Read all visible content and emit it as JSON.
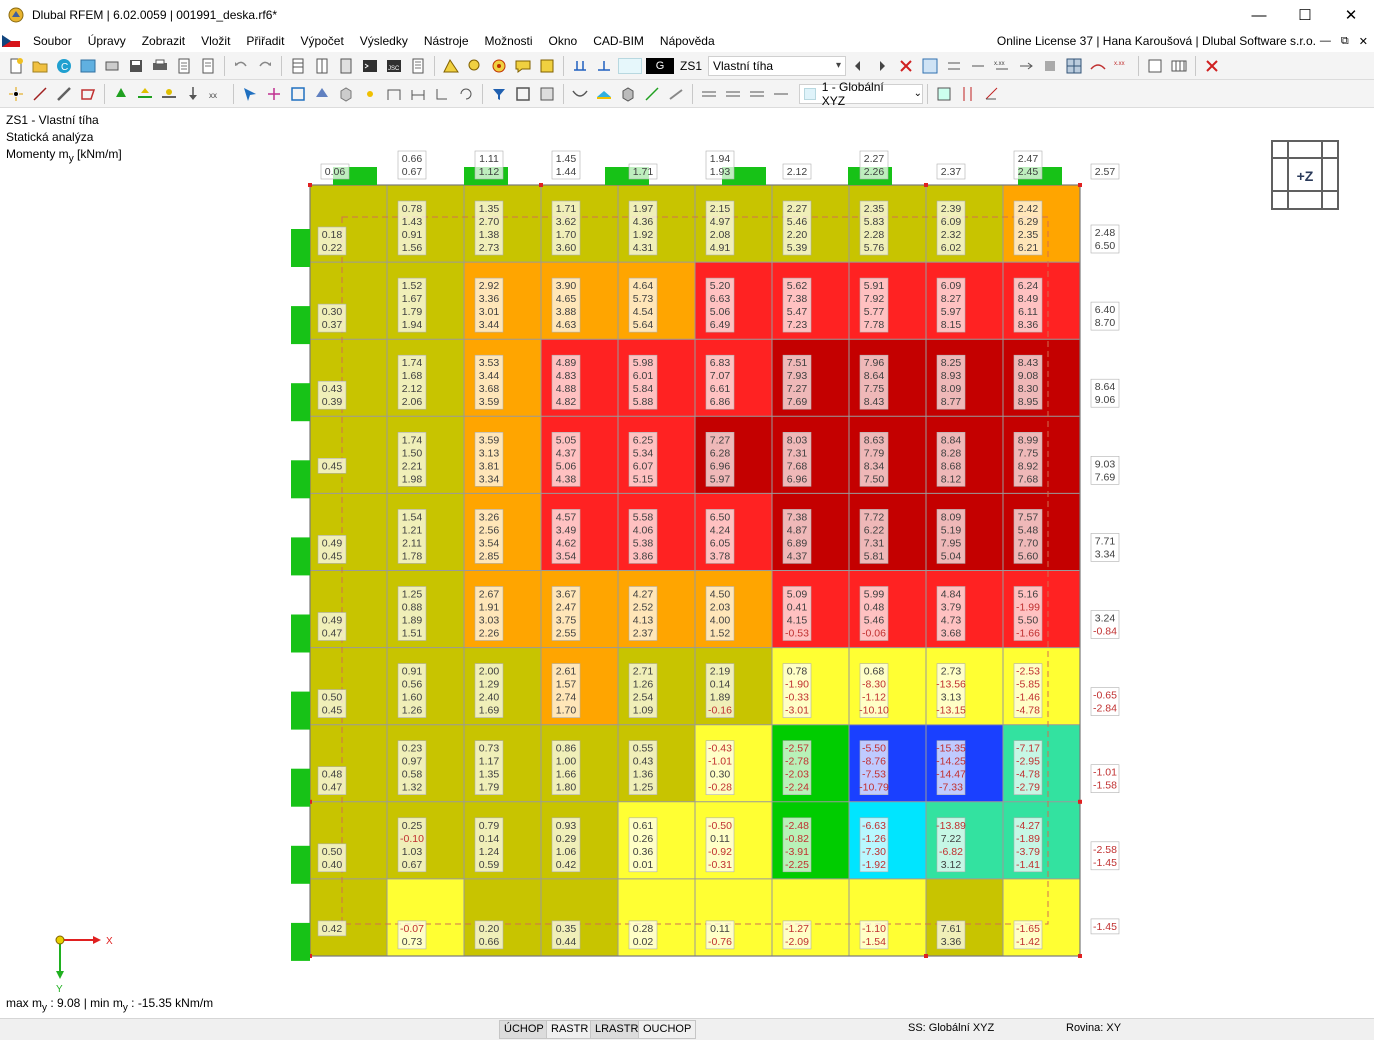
{
  "window": {
    "title": "Dlubal RFEM | 6.02.0059 | 001991_deska.rf6*",
    "controls": [
      "—",
      "☐",
      "✕"
    ]
  },
  "menu": {
    "items": [
      "Soubor",
      "Úpravy",
      "Zobrazit",
      "Vložit",
      "Přiřadit",
      "Výpočet",
      "Výsledky",
      "Nástroje",
      "Možnosti",
      "Okno",
      "CAD-BIM",
      "Nápověda"
    ],
    "license": "Online License 37 | Hana Karoušová | Dlubal Software s.r.o.",
    "mdi": [
      "—",
      "⧉",
      "✕"
    ]
  },
  "toolbar": {
    "load_case_g": "G",
    "load_case_id": "ZS1",
    "load_case_name": "Vlastní tíha",
    "coord_system": "1 - Globální XYZ"
  },
  "info": {
    "line1": "ZS1 - Vlastní tíha",
    "line2": "Statická analýza",
    "line3_prefix": "Momenty m",
    "line3_sub": "y",
    "line3_suffix": " [kNm/m]"
  },
  "view_cube": {
    "label": "+Z"
  },
  "axes": {
    "x": "X",
    "y": "Y"
  },
  "maxmin": {
    "max_label": "max m",
    "max_value": " : 9.08 | min m",
    "min_value": " : -15.35 kNm/m",
    "sub": "y"
  },
  "status": {
    "toggles": [
      {
        "label": "ÚCHOP",
        "on": true
      },
      {
        "label": "RASTR",
        "on": false
      },
      {
        "label": "LRASTR",
        "on": true
      },
      {
        "label": "OUCHOP",
        "on": false
      }
    ],
    "ss": "SS: Globální XYZ",
    "plane": "Rovina: XY"
  },
  "colors": {
    "olive": "#c8c400",
    "yellow": "#ffff33",
    "orange": "#ffa500",
    "red": "#ff2222",
    "darkred": "#c40000",
    "green": "#00cc00",
    "mint": "#33e2a0",
    "cyan": "#00e5ff",
    "blue": "#1a40ff",
    "navy": "#0000c0",
    "support": "#17c217"
  },
  "plate": {
    "cell_colors": [
      [
        "olive",
        "olive",
        "olive",
        "olive",
        "olive",
        "olive",
        "olive",
        "olive",
        "olive",
        "orange"
      ],
      [
        "olive",
        "olive",
        "orange",
        "orange",
        "orange",
        "red",
        "red",
        "red",
        "red",
        "red"
      ],
      [
        "olive",
        "olive",
        "orange",
        "red",
        "red",
        "red",
        "darkred",
        "darkred",
        "darkred",
        "darkred"
      ],
      [
        "olive",
        "olive",
        "orange",
        "red",
        "red",
        "darkred",
        "darkred",
        "darkred",
        "darkred",
        "darkred"
      ],
      [
        "olive",
        "olive",
        "orange",
        "red",
        "red",
        "red",
        "darkred",
        "darkred",
        "darkred",
        "darkred"
      ],
      [
        "olive",
        "olive",
        "orange",
        "orange",
        "orange",
        "orange",
        "red",
        "red",
        "red",
        "red"
      ],
      [
        "olive",
        "olive",
        "olive",
        "orange",
        "olive",
        "olive",
        "yellow",
        "yellow",
        "yellow",
        "yellow"
      ],
      [
        "olive",
        "olive",
        "olive",
        "olive",
        "olive",
        "yellow",
        "green",
        "blue",
        "blue",
        "mint"
      ],
      [
        "olive",
        "olive",
        "olive",
        "olive",
        "yellow",
        "yellow",
        "green",
        "cyan",
        "mint",
        "mint"
      ],
      [
        "olive",
        "yellow",
        "olive",
        "olive",
        "yellow",
        "yellow",
        "yellow",
        "yellow",
        "olive",
        "yellow"
      ]
    ],
    "cell_values": [
      [
        [
          "0.78",
          "1.43",
          "0.91",
          "1.56"
        ],
        [
          "1.35",
          "2.70",
          "1.38",
          "2.73"
        ],
        [
          "1.71",
          "3.62",
          "1.70",
          "3.60"
        ],
        [
          "1.97",
          "4.36",
          "1.92",
          "4.31"
        ],
        [
          "2.15",
          "4.97",
          "2.08",
          "4.91"
        ],
        [
          "2.27",
          "5.46",
          "2.20",
          "5.39"
        ],
        [
          "2.35",
          "5.83",
          "2.28",
          "5.76"
        ],
        [
          "2.39",
          "6.09",
          "2.32",
          "6.02"
        ],
        [
          "2.42",
          "6.29",
          "2.35",
          "6.21"
        ]
      ],
      [
        [
          "1.52",
          "1.67",
          "1.79",
          "1.94"
        ],
        [
          "2.92",
          "3.36",
          "3.01",
          "3.44"
        ],
        [
          "3.90",
          "4.65",
          "3.88",
          "4.63"
        ],
        [
          "4.64",
          "5.73",
          "4.54",
          "5.64"
        ],
        [
          "5.20",
          "6.63",
          "5.06",
          "6.49"
        ],
        [
          "5.62",
          "7.38",
          "5.47",
          "7.23"
        ],
        [
          "5.91",
          "7.92",
          "5.77",
          "7.78"
        ],
        [
          "6.09",
          "8.27",
          "5.97",
          "8.15"
        ],
        [
          "6.24",
          "8.49",
          "6.11",
          "8.36"
        ]
      ],
      [
        [
          "1.74",
          "1.68",
          "2.12",
          "2.06"
        ],
        [
          "3.53",
          "3.44",
          "3.68",
          "3.59"
        ],
        [
          "4.89",
          "4.83",
          "4.88",
          "4.82"
        ],
        [
          "5.98",
          "6.01",
          "5.84",
          "5.88"
        ],
        [
          "6.83",
          "7.07",
          "6.61",
          "6.86"
        ],
        [
          "7.51",
          "7.93",
          "7.27",
          "7.69"
        ],
        [
          "7.96",
          "8.64",
          "7.75",
          "8.43"
        ],
        [
          "8.25",
          "8.93",
          "8.09",
          "8.77"
        ],
        [
          "8.43",
          "9.08",
          "8.30",
          "8.95"
        ]
      ],
      [
        [
          "1.74",
          "1.50",
          "2.21",
          "1.98"
        ],
        [
          "3.59",
          "3.13",
          "3.81",
          "3.34"
        ],
        [
          "5.05",
          "4.37",
          "5.06",
          "4.38"
        ],
        [
          "6.25",
          "5.34",
          "6.07",
          "5.15"
        ],
        [
          "7.27",
          "6.28",
          "6.96",
          "5.97"
        ],
        [
          "8.03",
          "7.31",
          "7.68",
          "6.96"
        ],
        [
          "8.63",
          "7.79",
          "8.34",
          "7.50"
        ],
        [
          "8.84",
          "8.28",
          "8.68",
          "8.12"
        ],
        [
          "8.99",
          "7.75",
          "8.92",
          "7.68"
        ]
      ],
      [
        [
          "1.54",
          "1.21",
          "2.11",
          "1.78"
        ],
        [
          "3.26",
          "2.56",
          "3.54",
          "2.85"
        ],
        [
          "4.57",
          "3.49",
          "4.62",
          "3.54"
        ],
        [
          "5.58",
          "4.06",
          "5.38",
          "3.86"
        ],
        [
          "6.50",
          "4.24",
          "6.05",
          "3.78"
        ],
        [
          "7.38",
          "4.87",
          "6.89",
          "4.37"
        ],
        [
          "7.72",
          "6.22",
          "7.31",
          "5.81"
        ],
        [
          "8.09",
          "5.19",
          "7.95",
          "5.04"
        ],
        [
          "7.57",
          "5.48",
          "7.70",
          "5.60"
        ]
      ],
      [
        [
          "1.25",
          "0.88",
          "1.89",
          "1.51"
        ],
        [
          "2.67",
          "1.91",
          "3.03",
          "2.26"
        ],
        [
          "3.67",
          "2.47",
          "3.75",
          "2.55"
        ],
        [
          "4.27",
          "2.52",
          "4.13",
          "2.37"
        ],
        [
          "4.50",
          "2.03",
          "4.00",
          "1.52"
        ],
        [
          "5.09",
          "0.41",
          "4.15",
          "-0.53"
        ],
        [
          "5.99",
          "0.48",
          "5.46",
          "-0.06"
        ],
        [
          "4.84",
          "3.79",
          "4.73",
          "3.68"
        ],
        [
          "5.16",
          "-1.99",
          "5.50",
          "-1.66"
        ]
      ],
      [
        [
          "0.91",
          "0.56",
          "1.60",
          "1.26"
        ],
        [
          "2.00",
          "1.29",
          "2.40",
          "1.69"
        ],
        [
          "2.61",
          "1.57",
          "2.74",
          "1.70"
        ],
        [
          "2.71",
          "1.26",
          "2.54",
          "1.09"
        ],
        [
          "2.19",
          "0.14",
          "1.89",
          "-0.16"
        ],
        [
          "0.78",
          "-1.90",
          "-0.33",
          "-3.01"
        ],
        [
          "0.68",
          "-8.30",
          "-1.12",
          "-10.10"
        ],
        [
          "2.73",
          "-13.56",
          "3.13",
          "-13.15"
        ],
        [
          "-2.53",
          "-5.85",
          "-1.46",
          "-4.78"
        ]
      ],
      [
        [
          "0.23",
          "0.97",
          "0.58",
          "1.32"
        ],
        [
          "0.73",
          "1.17",
          "1.35",
          "1.79"
        ],
        [
          "0.86",
          "1.00",
          "1.66",
          "1.80"
        ],
        [
          "0.55",
          "0.43",
          "1.36",
          "1.25"
        ],
        [
          "-0.43",
          "-1.01",
          "0.30",
          "-0.28"
        ],
        [
          "-2.57",
          "-2.78",
          "-2.03",
          "-2.24"
        ],
        [
          "-5.50",
          "-8.76",
          "-7.53",
          "-10.79"
        ],
        [
          "-15.35",
          "-14.25",
          "-14.47",
          "-7.33"
        ],
        [
          "-7.17",
          "-2.95",
          "-4.78",
          "-2.79"
        ]
      ],
      [
        [
          "0.25",
          "-0.10",
          "1.03",
          "0.67"
        ],
        [
          "0.79",
          "0.14",
          "1.24",
          "0.59"
        ],
        [
          "0.93",
          "0.29",
          "1.06",
          "0.42"
        ],
        [
          "0.61",
          "0.26",
          "0.36",
          "0.01"
        ],
        [
          "-0.50",
          "0.11",
          "-0.92",
          "-0.31"
        ],
        [
          "-2.48",
          "-0.82",
          "-3.91",
          "-2.25"
        ],
        [
          "-6.63",
          "-1.26",
          "-7.30",
          "-1.92"
        ],
        [
          "-13.89",
          "7.22",
          "-6.82",
          "3.12"
        ],
        [
          "-4.27",
          "-1.89",
          "-3.79",
          "-1.41"
        ]
      ]
    ],
    "top_labels": [
      [
        "0.06"
      ],
      [
        "0.66",
        "0.67"
      ],
      [
        "1.11",
        "1.12"
      ],
      [
        "1.45",
        "1.44"
      ],
      [
        "1.71"
      ],
      [
        "1.94",
        "1.93"
      ],
      [
        "2.12"
      ],
      [
        "2.27",
        "2.26"
      ],
      [
        "2.37"
      ],
      [
        "2.47",
        "2.45"
      ],
      [
        "2.57"
      ]
    ],
    "left_labels": [
      [
        "0.18",
        "0.22"
      ],
      [
        "0.30",
        "0.37"
      ],
      [
        "0.43",
        "0.39"
      ],
      [
        "0.45"
      ],
      [
        "0.49",
        "0.45"
      ],
      [
        "0.49",
        "0.47"
      ],
      [
        "0.50",
        "0.45"
      ],
      [
        "0.48",
        "0.47"
      ],
      [
        "0.50",
        "0.40"
      ],
      [
        "0.42"
      ]
    ],
    "right_labels": [
      [
        "2.48",
        "6.50"
      ],
      [
        "6.40",
        "8.70"
      ],
      [
        "8.64",
        "9.06"
      ],
      [
        "9.03",
        "7.69"
      ],
      [
        "7.71",
        "3.34"
      ],
      [
        "3.24",
        "-0.84"
      ],
      [
        "-0.65",
        "-2.84"
      ],
      [
        "-1.01",
        "-1.58"
      ],
      [
        "-2.58",
        "-1.45"
      ],
      [
        "-1.45"
      ]
    ],
    "bottom_labels": [
      [
        "-0.07",
        "0.73"
      ],
      [
        "0.20",
        "0.66"
      ],
      [
        "0.35",
        "0.44"
      ],
      [
        "0.28",
        "0.02"
      ],
      [
        "0.11",
        "-0.76"
      ],
      [
        "-1.27",
        "-2.09"
      ],
      [
        "-1.10",
        "-1.54"
      ],
      [
        "7.61",
        "3.36"
      ],
      [
        "-1.65",
        "-1.42"
      ]
    ]
  }
}
